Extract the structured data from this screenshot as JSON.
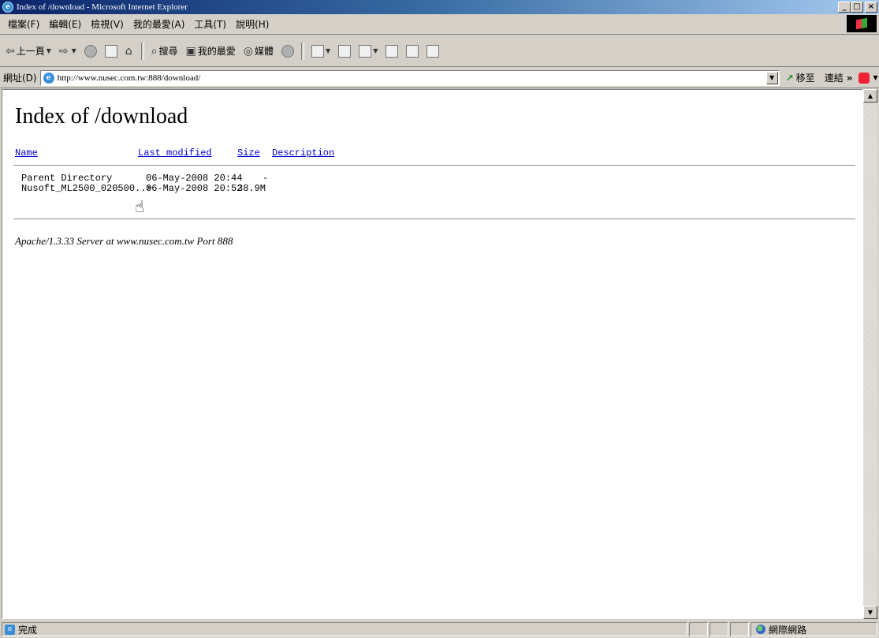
{
  "window": {
    "title": "Index of /download - Microsoft Internet Explorer",
    "controls": {
      "minimize": "_",
      "maximize": "□",
      "close": "×"
    }
  },
  "menu": [
    "檔案(F)",
    "編輯(E)",
    "檢視(V)",
    "我的最愛(A)",
    "工具(T)",
    "說明(H)"
  ],
  "toolbar": {
    "back": "上一頁",
    "search": "搜尋",
    "favorites": "我的最愛",
    "media": "媒體"
  },
  "address": {
    "label": "網址(D)",
    "url": "http://www.nusec.com.tw:888/download/",
    "go": "移至",
    "links": "連結"
  },
  "page": {
    "heading": "Index of /download",
    "columns": {
      "name": "Name",
      "modified": "Last modified",
      "size": "Size",
      "description": "Description"
    },
    "rows": [
      {
        "name": "Parent Directory",
        "modified": "06-May-2008 20:44",
        "size": "-"
      },
      {
        "name": "Nusoft_ML2500_020500..>",
        "modified": "06-May-2008 20:52",
        "size": "38.9M"
      }
    ],
    "footer": "Apache/1.3.33 Server at www.nusec.com.tw Port 888"
  },
  "status": {
    "text": "完成",
    "zone": "網際網路"
  }
}
